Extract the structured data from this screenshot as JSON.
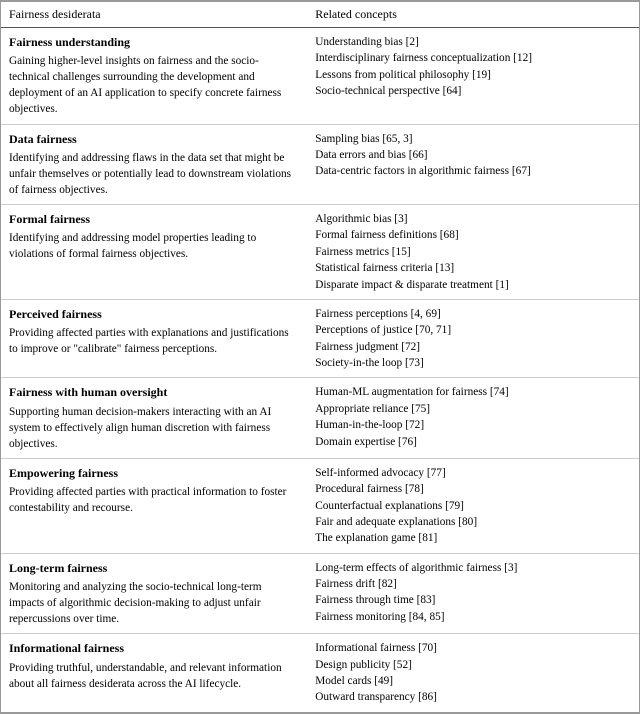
{
  "table": {
    "col1_header": "Fairness desiderata",
    "col2_header": "Related concepts",
    "rows": [
      {
        "title": "Fairness understanding",
        "desc": "Gaining higher-level insights on fairness and the socio-technical challenges surrounding the development and deployment of an AI application to specify concrete fairness objectives.",
        "related": [
          "Understanding bias [2]",
          "Interdisciplinary fairness conceptualization [12]",
          "Lessons from political philosophy [19]",
          "Socio-technical perspective [64]"
        ]
      },
      {
        "title": "Data fairness",
        "desc": "Identifying and addressing flaws in the data set that might be unfair themselves or potentially lead to downstream violations of fairness objectives.",
        "related": [
          "Sampling bias [65, 3]",
          "Data errors and bias [66]",
          "Data-centric factors in algorithmic fairness [67]"
        ]
      },
      {
        "title": "Formal fairness",
        "desc": "Identifying and addressing model properties leading to violations of formal fairness objectives.",
        "related": [
          "Algorithmic bias [3]",
          "Formal fairness definitions [68]",
          "Fairness metrics [15]",
          "Statistical fairness criteria [13]",
          "Disparate impact & disparate treatment [1]"
        ]
      },
      {
        "title": "Perceived fairness",
        "desc": "Providing affected parties with explanations and justifications to improve or \"calibrate\" fairness perceptions.",
        "related": [
          "Fairness perceptions [4, 69]",
          "Perceptions of justice [70, 71]",
          "Fairness judgment [72]",
          "Society-in-the loop [73]"
        ]
      },
      {
        "title": "Fairness with human oversight",
        "desc": "Supporting human decision-makers interacting with an AI system to effectively align human discretion with fairness objectives.",
        "related": [
          "Human-ML augmentation for fairness [74]",
          "Appropriate reliance [75]",
          "Human-in-the-loop [72]",
          "Domain expertise [76]"
        ]
      },
      {
        "title": "Empowering fairness",
        "desc": "Providing affected parties with practical information to foster contestability and recourse.",
        "related": [
          "Self-informed advocacy [77]",
          "Procedural fairness [78]",
          "Counterfactual explanations [79]",
          "Fair and adequate explanations [80]",
          "The explanation game [81]"
        ]
      },
      {
        "title": "Long-term fairness",
        "desc": "Monitoring and analyzing the socio-technical long-term impacts of algorithmic decision-making to adjust unfair repercussions over time.",
        "related": [
          "Long-term effects of algorithmic fairness [3]",
          "Fairness drift [82]",
          "Fairness through time [83]",
          "Fairness monitoring [84, 85]"
        ]
      },
      {
        "title": "Informational fairness",
        "desc": "Providing truthful, understandable, and relevant information about all fairness desiderata across the AI lifecycle.",
        "related": [
          "Informational fairness [70]",
          "Design publicity [52]",
          "Model cards [49]",
          "Outward transparency [86]"
        ]
      }
    ]
  }
}
